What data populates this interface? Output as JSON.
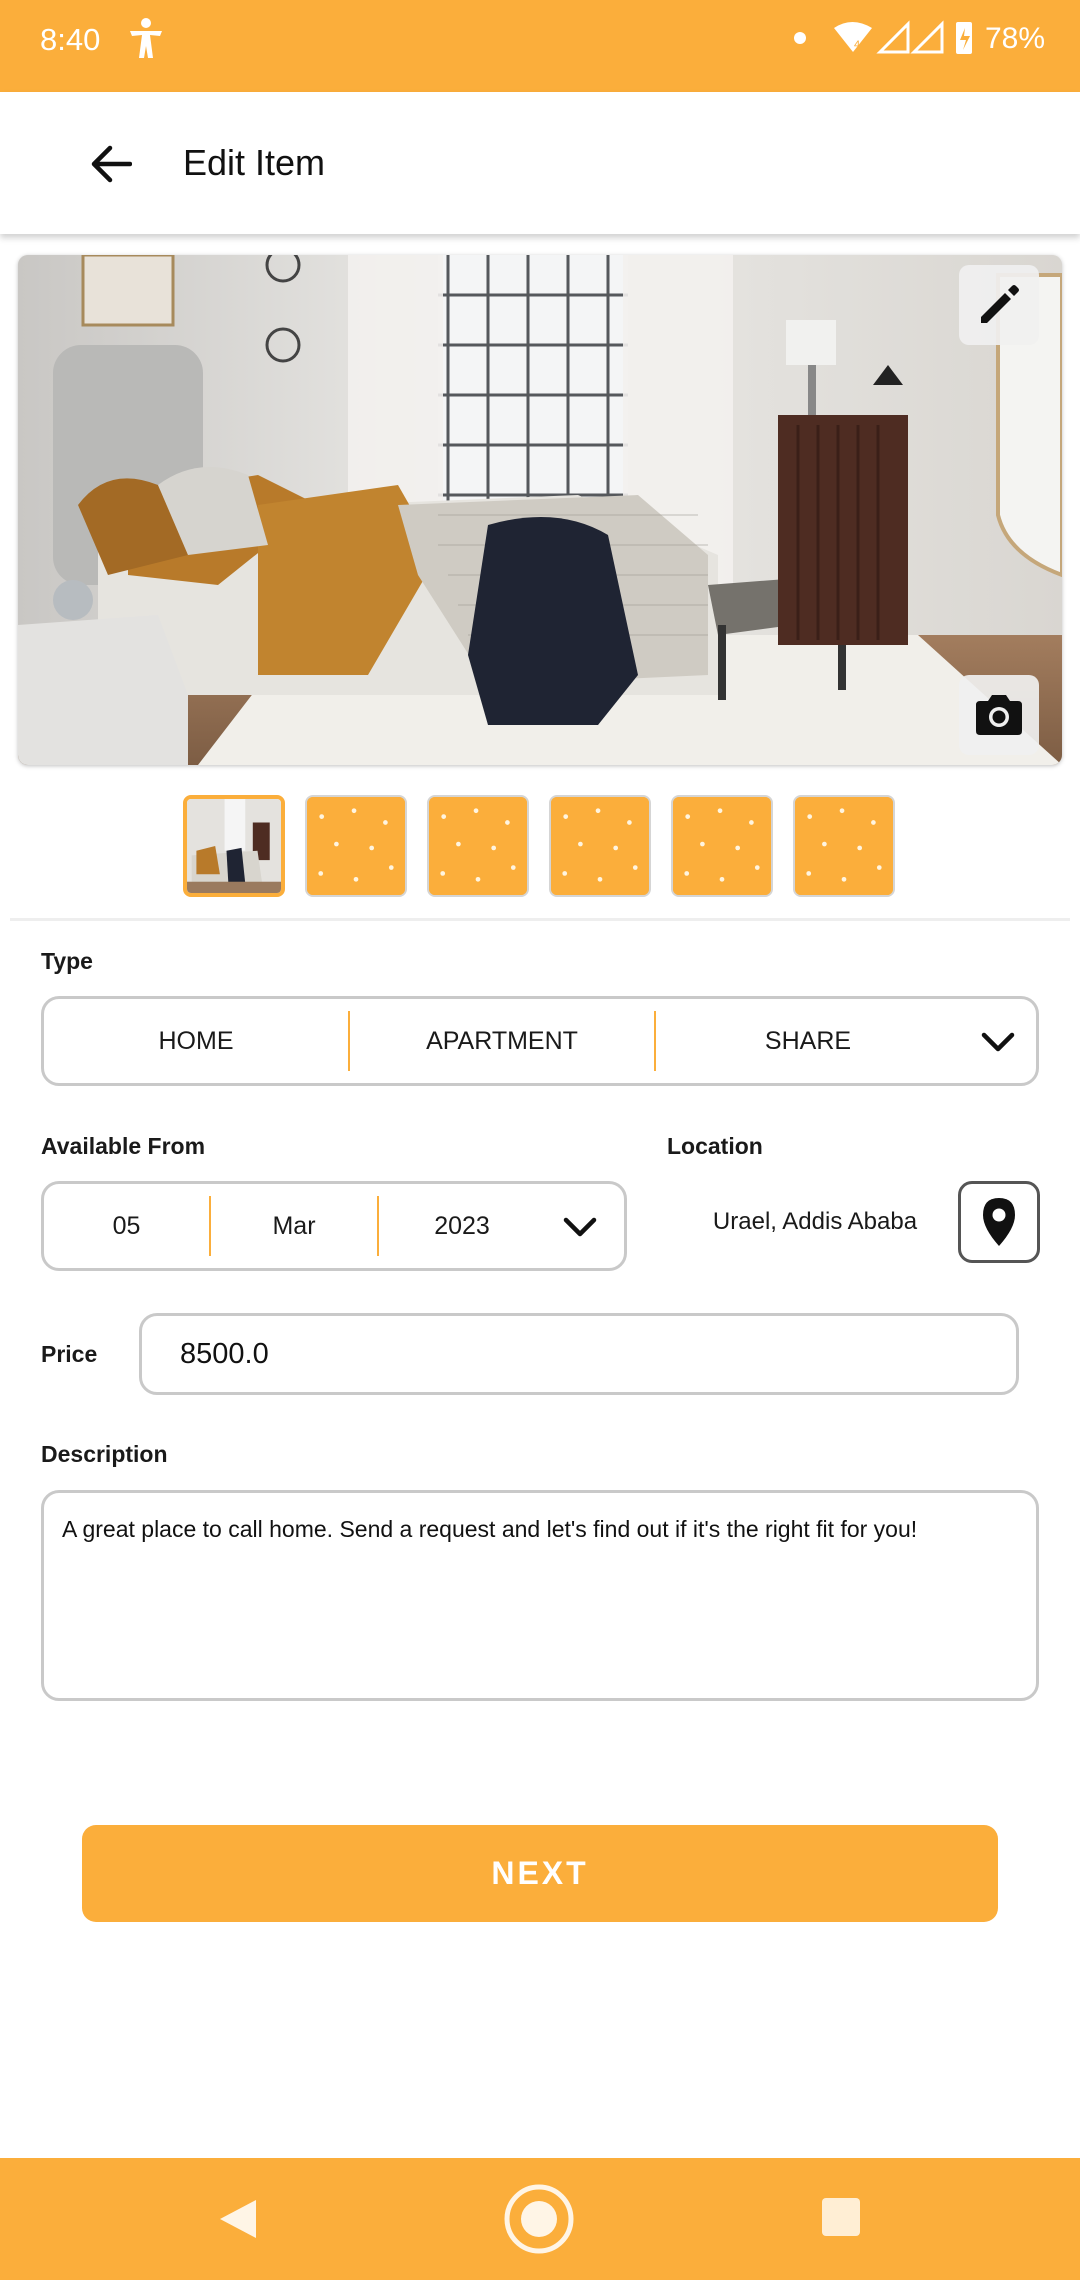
{
  "status_bar": {
    "time": "8:40",
    "battery": "78%",
    "accessibility_icon": "accessibility-icon",
    "network_icons": [
      "wifi-icon",
      "signal-icon",
      "signal-icon",
      "battery-icon"
    ]
  },
  "app_bar": {
    "title": "Edit Item",
    "back_icon": "arrow-back-icon"
  },
  "gallery": {
    "edit_icon": "pencil-icon",
    "camera_icon": "camera-icon",
    "thumbnails": [
      {
        "kind": "photo",
        "selected": true
      },
      {
        "kind": "placeholder",
        "selected": false
      },
      {
        "kind": "placeholder",
        "selected": false
      },
      {
        "kind": "placeholder",
        "selected": false
      },
      {
        "kind": "placeholder",
        "selected": false
      },
      {
        "kind": "placeholder",
        "selected": false
      }
    ]
  },
  "form": {
    "type_label": "Type",
    "type_options": [
      "HOME",
      "APARTMENT",
      "SHARE"
    ],
    "available_label": "Available From",
    "date_day": "05",
    "date_month": "Mar",
    "date_year": "2023",
    "location_label": "Location",
    "location_value": "Urael, Addis Ababa",
    "location_icon": "map-pin-icon",
    "price_label": "Price",
    "price_value": "8500.0",
    "description_label": "Description",
    "description_value": "A great place to call home. Send a request and let's find out if it's the right fit for you!"
  },
  "actions": {
    "next_label": "NEXT"
  },
  "colors": {
    "accent": "#FBAE3B",
    "border": "#C9C9C9"
  }
}
